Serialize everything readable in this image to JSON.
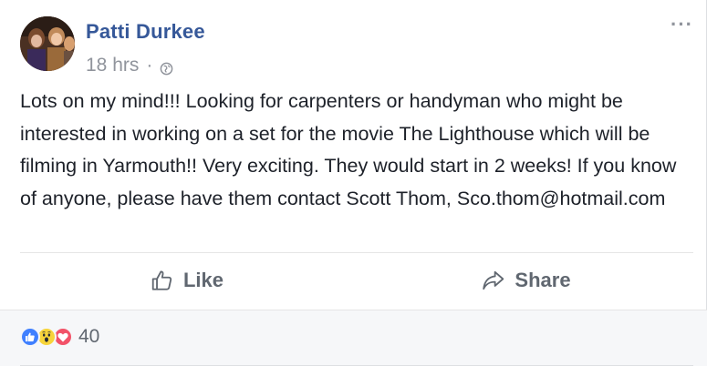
{
  "post": {
    "author": "Patti Durkee",
    "time": "18 hrs",
    "separator": "·",
    "privacy_icon": "globe-icon",
    "more_label": "···",
    "text": "Lots on my mind!!! Looking for carpenters or handyman who might be interested in working on a set for the movie The Lighthouse which will be filming in Yarmouth!! Very exciting. They would start in 2 weeks! If you know of anyone, please have them contact Scott Thom, Sco.thom@hotmail.com"
  },
  "actions": {
    "like_label": "Like",
    "like_icon": "thumbs-up-icon",
    "share_label": "Share",
    "share_icon": "share-arrow-icon"
  },
  "reactions": {
    "icons": [
      "like-reaction-icon",
      "wow-reaction-icon",
      "love-reaction-icon"
    ],
    "count": "40"
  },
  "colors": {
    "author": "#365899",
    "meta": "#90949c",
    "action": "#606770",
    "like_reaction": "#4080ff",
    "wow_reaction": "#f7d43a",
    "love_reaction": "#f25268",
    "footer_bg": "#f6f7f9"
  }
}
